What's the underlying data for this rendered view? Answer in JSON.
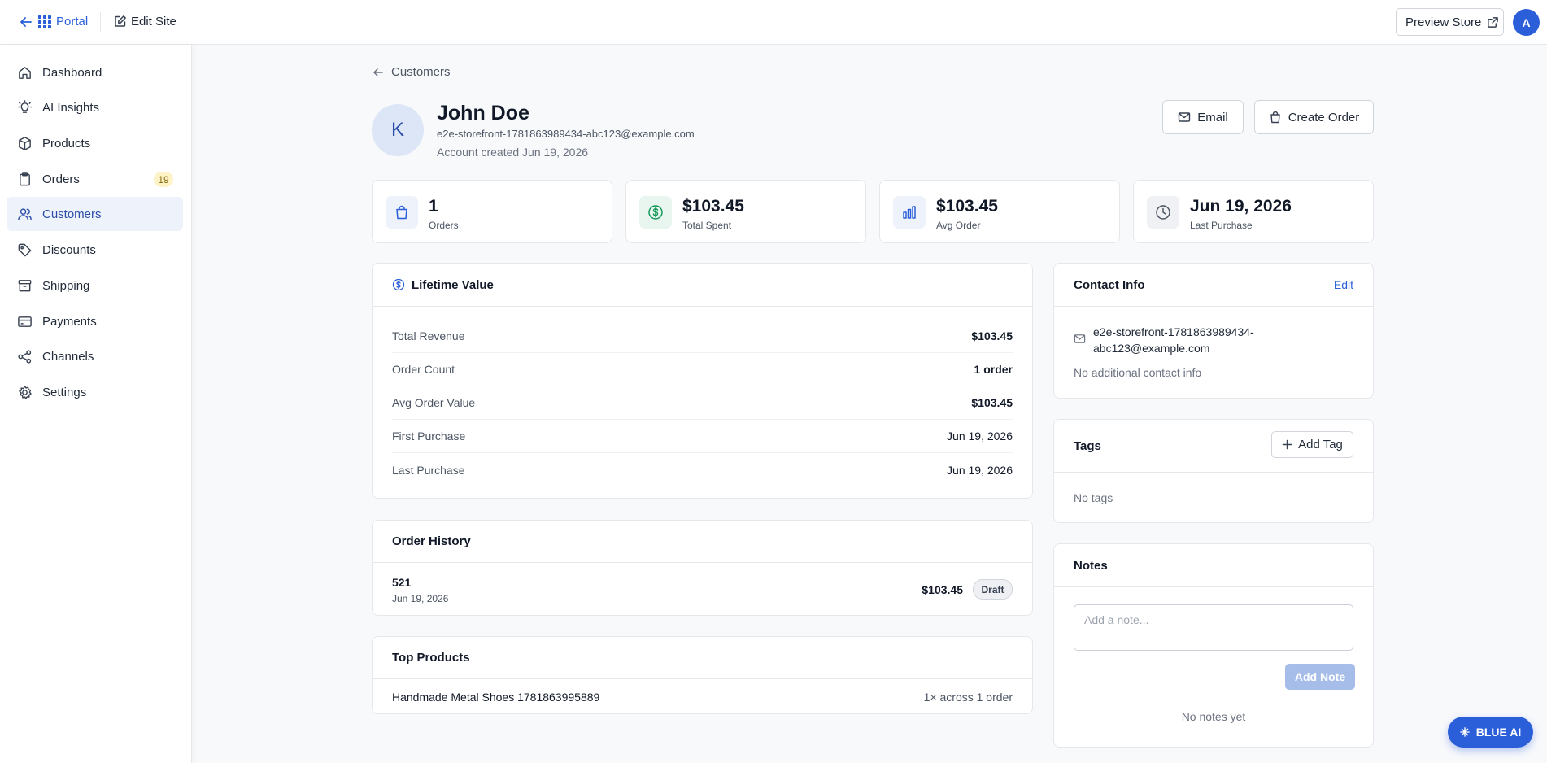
{
  "topbar": {
    "portal_label": "Portal",
    "edit_site_label": "Edit Site",
    "preview_store_label": "Preview Store",
    "user_initial": "A"
  },
  "sidebar": {
    "items": [
      {
        "label": "Dashboard",
        "icon": "home-icon"
      },
      {
        "label": "AI Insights",
        "icon": "lightbulb-icon"
      },
      {
        "label": "Products",
        "icon": "box-icon"
      },
      {
        "label": "Orders",
        "icon": "clipboard-icon",
        "badge": "19"
      },
      {
        "label": "Customers",
        "icon": "users-icon",
        "active": true
      },
      {
        "label": "Discounts",
        "icon": "tag-icon"
      },
      {
        "label": "Shipping",
        "icon": "archive-icon"
      },
      {
        "label": "Payments",
        "icon": "credit-card-icon"
      },
      {
        "label": "Channels",
        "icon": "share-icon"
      },
      {
        "label": "Settings",
        "icon": "gear-icon"
      }
    ]
  },
  "breadcrumb": {
    "back_label": "Customers"
  },
  "customer": {
    "initial": "K",
    "name": "John Doe",
    "email": "e2e-storefront-1781863989434-abc123@example.com",
    "created": "Account created Jun 19, 2026"
  },
  "actions": {
    "email_label": "Email",
    "create_order_label": "Create Order"
  },
  "stats": [
    {
      "value": "1",
      "label": "Orders",
      "icon": "shopping-bag-icon"
    },
    {
      "value": "$103.45",
      "label": "Total Spent",
      "icon": "dollar-icon"
    },
    {
      "value": "$103.45",
      "label": "Avg Order",
      "icon": "bar-chart-icon"
    },
    {
      "value": "Jun 19, 2026",
      "label": "Last Purchase",
      "icon": "clock-icon"
    }
  ],
  "lifetime_value": {
    "title": "Lifetime Value",
    "rows": [
      {
        "label": "Total Revenue",
        "value": "$103.45"
      },
      {
        "label": "Order Count",
        "value": "1 order"
      },
      {
        "label": "Avg Order Value",
        "value": "$103.45"
      },
      {
        "label": "First Purchase",
        "value": "Jun 19, 2026"
      },
      {
        "label": "Last Purchase",
        "value": "Jun 19, 2026"
      }
    ]
  },
  "order_history": {
    "title": "Order History",
    "orders": [
      {
        "number": "521",
        "date": "Jun 19, 2026",
        "total": "$103.45",
        "status": "Draft"
      }
    ]
  },
  "top_products": {
    "title": "Top Products",
    "items": [
      {
        "name": "Handmade Metal Shoes 1781863995889",
        "summary": "1× across 1 order"
      }
    ]
  },
  "contact_info": {
    "title": "Contact Info",
    "edit_label": "Edit",
    "email_line1": "e2e-storefront-1781863989434-",
    "email_line2": "abc123@example.com",
    "empty_text": "No additional contact info"
  },
  "tags": {
    "title": "Tags",
    "add_label": "Add Tag",
    "empty_text": "No tags"
  },
  "notes": {
    "title": "Notes",
    "placeholder": "Add a note...",
    "add_label": "Add Note",
    "empty_text": "No notes yet"
  },
  "assistant": {
    "label": "BLUE AI"
  },
  "colors": {
    "accent": "#2b5fd9",
    "badge_bg": "#fdf3c7",
    "active_bg": "#eef2fb"
  }
}
